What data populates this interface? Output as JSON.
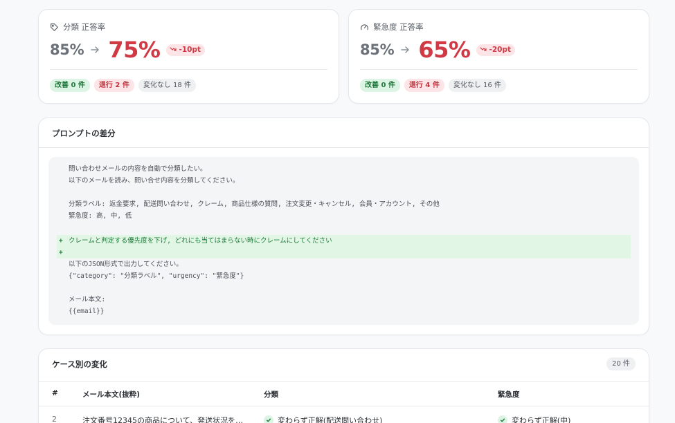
{
  "metrics": [
    {
      "icon": "tag-icon",
      "label": "分類 正答率",
      "before": "85%",
      "after": "75%",
      "delta": "-10pt",
      "chips": {
        "improved": "改善 0 件",
        "regressed": "退行 2 件",
        "unchanged": "変化なし 18 件"
      }
    },
    {
      "icon": "gauge-icon",
      "label": "緊急度 正答率",
      "before": "85%",
      "after": "65%",
      "delta": "-20pt",
      "chips": {
        "improved": "改善 0 件",
        "regressed": "退行 4 件",
        "unchanged": "変化なし 16 件"
      }
    }
  ],
  "diff": {
    "title": "プロンプトの差分",
    "lines": [
      {
        "type": "context",
        "text": "問い合わせメールの内容を自動で分類したい。"
      },
      {
        "type": "context",
        "text": "以下のメールを読み、問い合せ内容を分類してください。"
      },
      {
        "type": "context",
        "text": ""
      },
      {
        "type": "context",
        "text": "分類ラベル: 返金要求, 配送問い合わせ, クレーム, 商品仕様の質問, 注文変更・キャンセル, 会員・アカウント, その他"
      },
      {
        "type": "context",
        "text": "緊急度: 高, 中, 低"
      },
      {
        "type": "context",
        "text": ""
      },
      {
        "type": "added",
        "sign": "+",
        "text": "クレームと判定する優先度を下げ, どれにも当てはまらない時にクレームにしてください"
      },
      {
        "type": "added",
        "sign": "+",
        "text": ""
      },
      {
        "type": "context",
        "text": "以下のJSON形式で出力してください。"
      },
      {
        "type": "context",
        "text": "{\"category\": \"分類ラベル\", \"urgency\": \"緊急度\"}"
      },
      {
        "type": "context",
        "text": ""
      },
      {
        "type": "context",
        "text": "メール本文:"
      },
      {
        "type": "context",
        "text": "{{email}}"
      }
    ]
  },
  "cases": {
    "title": "ケース別の変化",
    "count": "20 件",
    "columns": {
      "num": "#",
      "body": "メール本文(抜粋)",
      "category": "分類",
      "urgency": "緊急度"
    },
    "rows": [
      {
        "num": "2",
        "body": "注文番号12345の商品について、発送状況を…",
        "category": "変わらず正解(配送問い合わせ)",
        "urgency": "変わらず正解(中)"
      }
    ]
  },
  "colors": {
    "negative": "#cf3a45",
    "positive": "#237a3f",
    "added_bg": "#e1f6e5"
  }
}
